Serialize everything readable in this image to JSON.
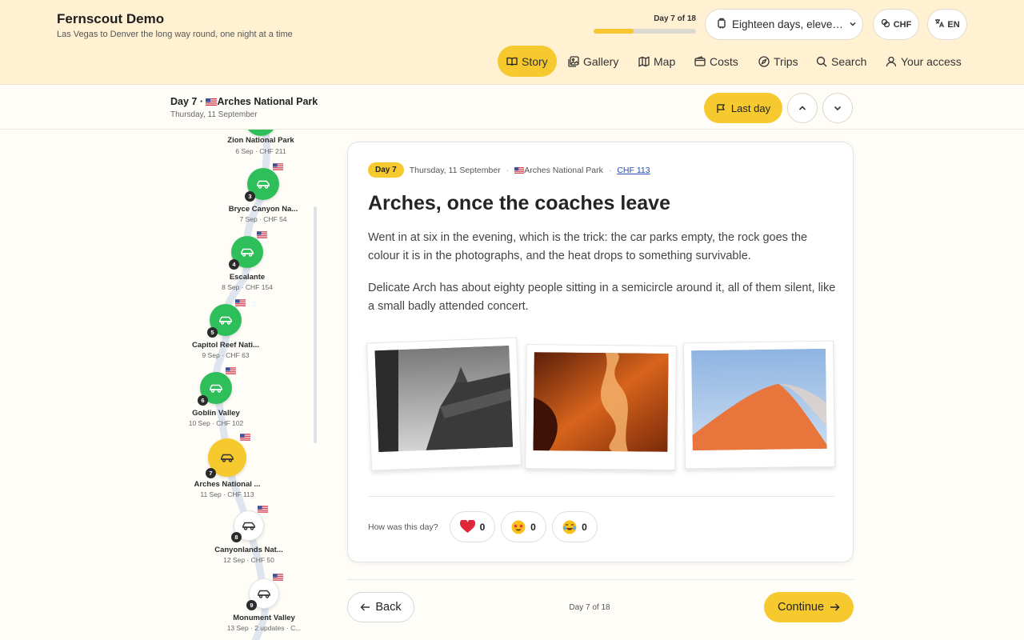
{
  "app": {
    "title": "Fernscout Demo",
    "subtitle": "Las Vegas to Denver the long way round, one night at a time"
  },
  "progress": {
    "label": "Day 7 of 18",
    "fraction": 0.389
  },
  "trip_select": {
    "value": "Eighteen days, eleven ..."
  },
  "currency": {
    "label": "CHF"
  },
  "language": {
    "label": "EN"
  },
  "nav": {
    "story": "Story",
    "gallery": "Gallery",
    "map": "Map",
    "costs": "Costs",
    "trips": "Trips",
    "search": "Search",
    "access": "Your access"
  },
  "day_header": {
    "prefix": "Day 7 ·",
    "flag": "us-flag-icon",
    "place": "Arches National Park",
    "date": "Thursday, 11 September",
    "last_day": "Last day"
  },
  "timeline": [
    {
      "num": "",
      "name": "Zion National Park",
      "meta": "6 Sep · CHF 211",
      "state": "done"
    },
    {
      "num": "3",
      "name": "Bryce Canyon Na...",
      "meta": "7 Sep · CHF 54",
      "state": "done"
    },
    {
      "num": "4",
      "name": "Escalante",
      "meta": "8 Sep · CHF 154",
      "state": "done"
    },
    {
      "num": "5",
      "name": "Capitol Reef Nati...",
      "meta": "9 Sep · CHF 63",
      "state": "done"
    },
    {
      "num": "6",
      "name": "Goblin Valley",
      "meta": "10 Sep · CHF 102",
      "state": "done"
    },
    {
      "num": "7",
      "name": "Arches National ...",
      "meta": "11 Sep · CHF 113",
      "state": "current"
    },
    {
      "num": "8",
      "name": "Canyonlands Nat...",
      "meta": "12 Sep · CHF 50",
      "state": "future"
    },
    {
      "num": "9",
      "name": "Monument Valley",
      "meta": "13 Sep · 2 updates · C...",
      "state": "future"
    }
  ],
  "post": {
    "day_badge": "Day 7",
    "date": "Thursday, 11 September",
    "place": "Arches National Park",
    "cost": "CHF 113",
    "title": "Arches, once the coaches leave",
    "para1": "Went in at six in the evening, which is the trick: the car parks empty, the rock goes the colour it is in the photographs, and the heat drops to something survivable.",
    "para2": "Delicate Arch has about eighty people sitting in a semicircle around it, all of them silent, like a small badly attended concert.",
    "reactions_label": "How was this day?",
    "reactions": [
      {
        "icon": "heart-icon",
        "count": "0"
      },
      {
        "icon": "star-struck-face-icon",
        "count": "0"
      },
      {
        "icon": "laughing-face-icon",
        "count": "0"
      }
    ]
  },
  "footer": {
    "back": "Back",
    "count": "Day 7 of 18",
    "continue": "Continue"
  },
  "colors": {
    "header_bg": "#fff1d2",
    "accent_yellow": "#f6c92e",
    "done_green": "#2fbf5a",
    "link_blue": "#224ab0"
  }
}
